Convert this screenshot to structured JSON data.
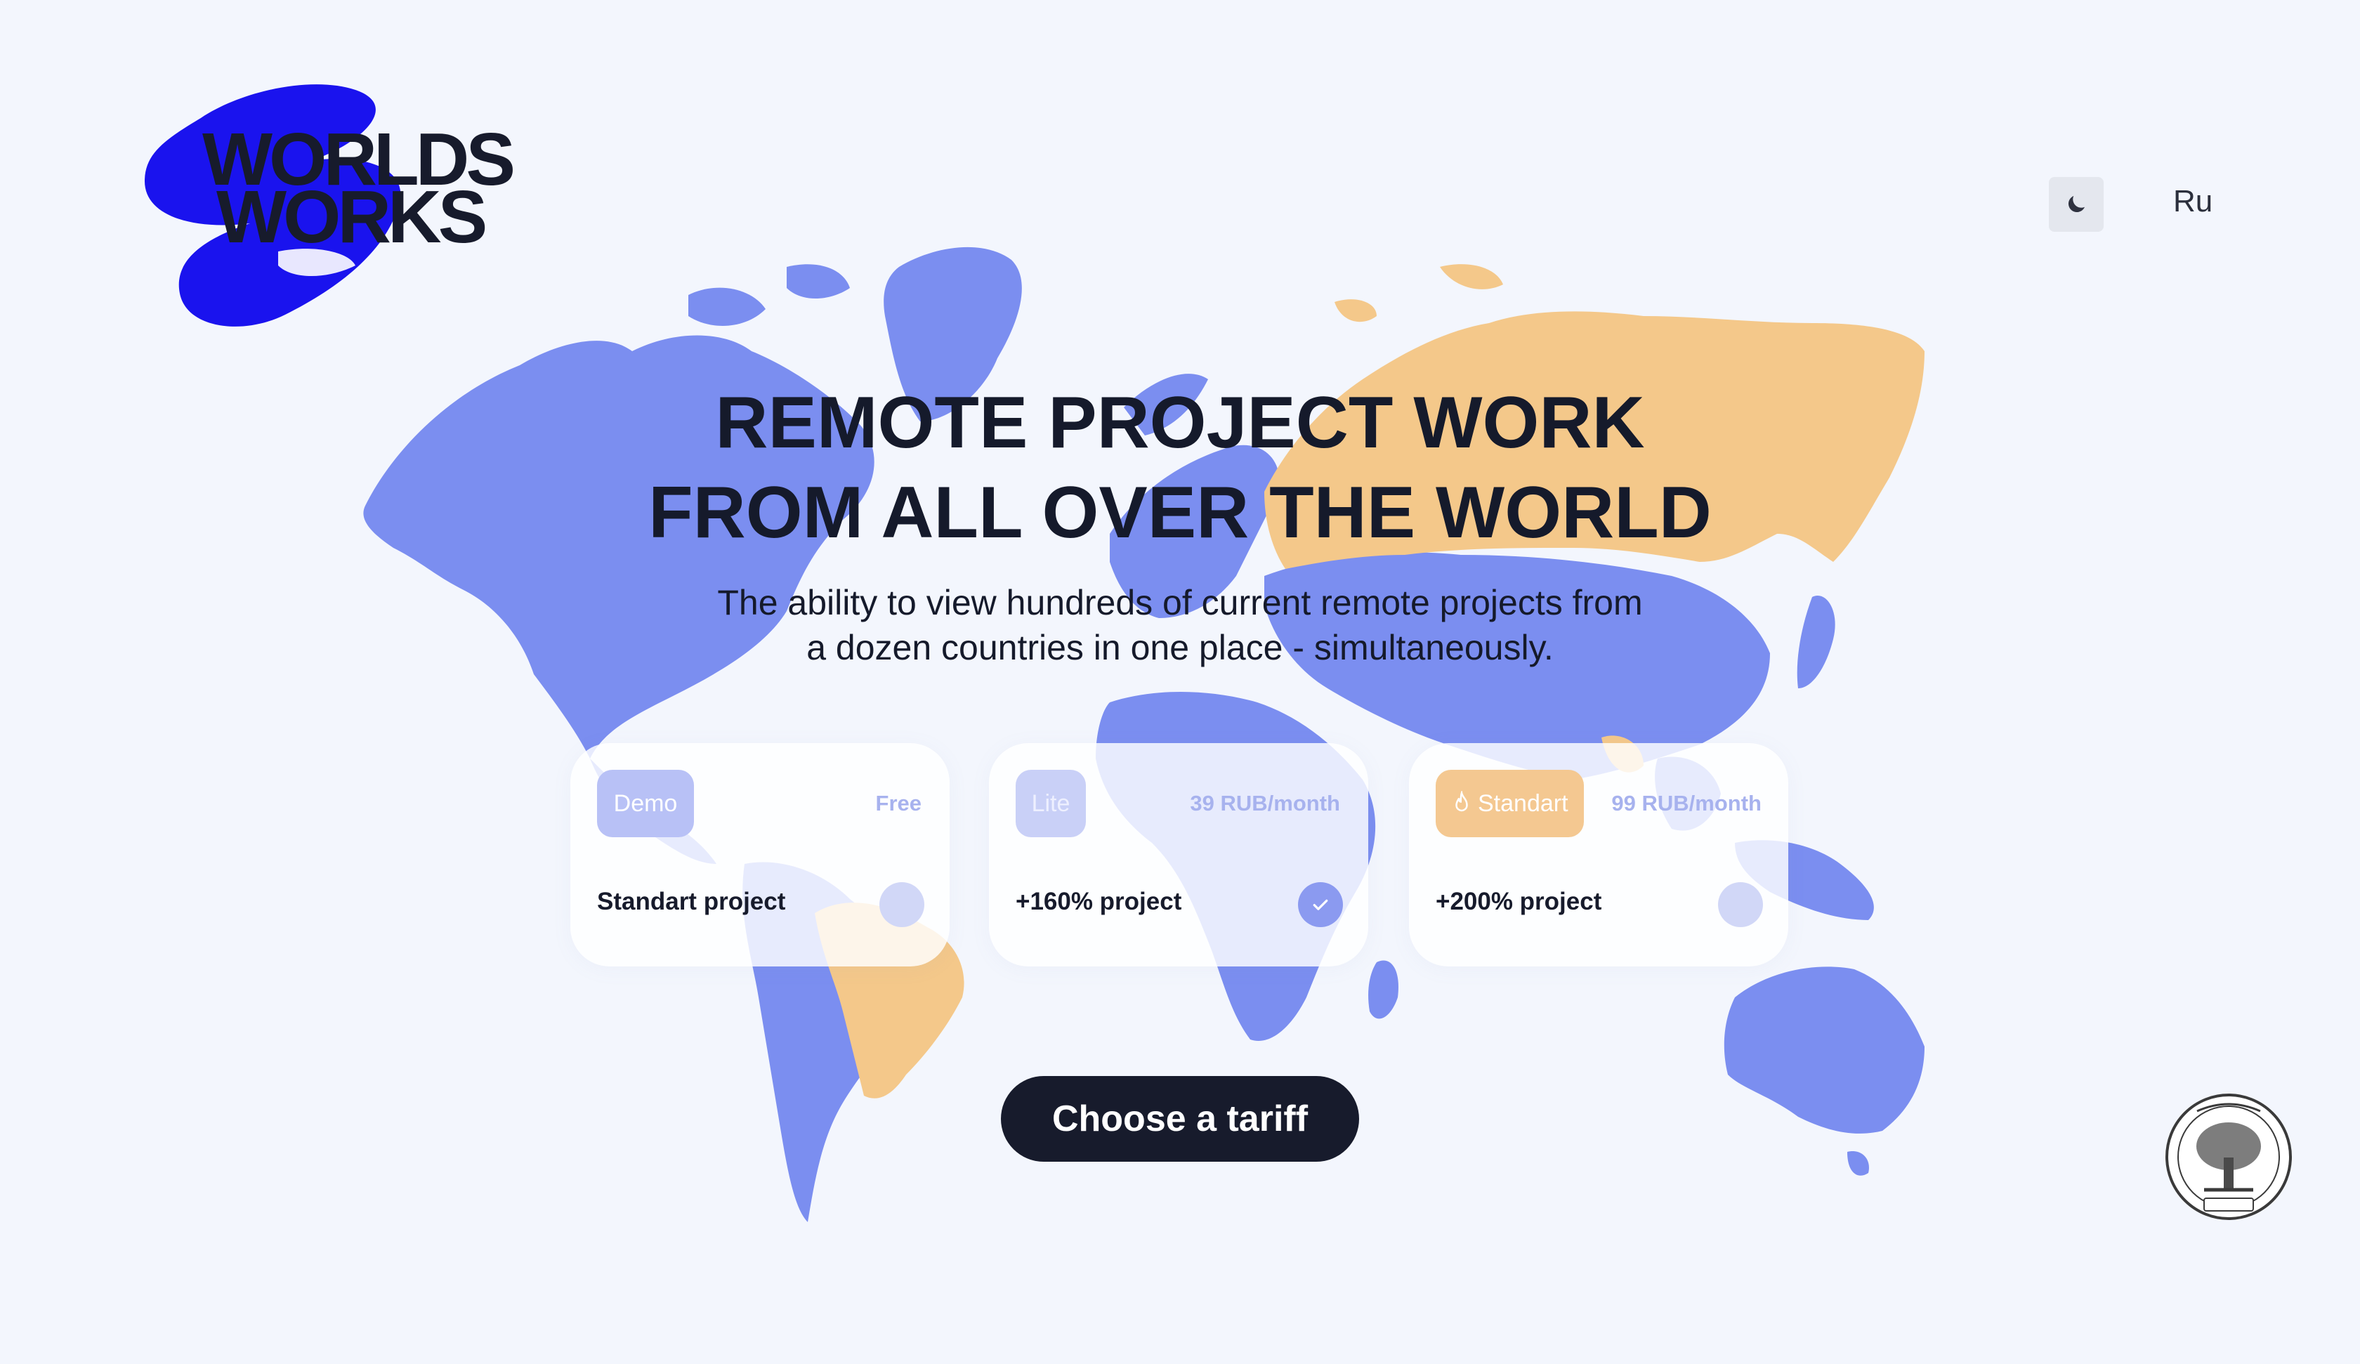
{
  "brand": {
    "logo_line1": "WORLDS",
    "logo_line2": "WORKS",
    "logo_color": "#1a13ee"
  },
  "header": {
    "theme_toggle_icon": "moon-icon",
    "language_label": "Ru"
  },
  "hero": {
    "headline_line1": "REMOTE PROJECT WORK",
    "headline_line2": "FROM ALL OVER THE WORLD",
    "subtitle_line1": "The ability to view hundreds of current remote projects from",
    "subtitle_line2": "a dozen countries in one place - simultaneously."
  },
  "tariffs": [
    {
      "badge": "Demo",
      "price": "Free",
      "feature": "Standart project",
      "selected": false
    },
    {
      "badge": "Lite",
      "price": "39 RUB/month",
      "feature": "+160% project",
      "selected": true
    },
    {
      "badge": "Standart",
      "badge_icon": "fire-icon",
      "price": "99 RUB/month",
      "feature": "+200% project",
      "selected": false
    }
  ],
  "cta": {
    "label": "Choose a tariff"
  },
  "colors": {
    "map_blue": "#7b8ef0",
    "map_orange": "#f4c88a",
    "background": "#f3f6fd",
    "dark": "#171b2c"
  }
}
